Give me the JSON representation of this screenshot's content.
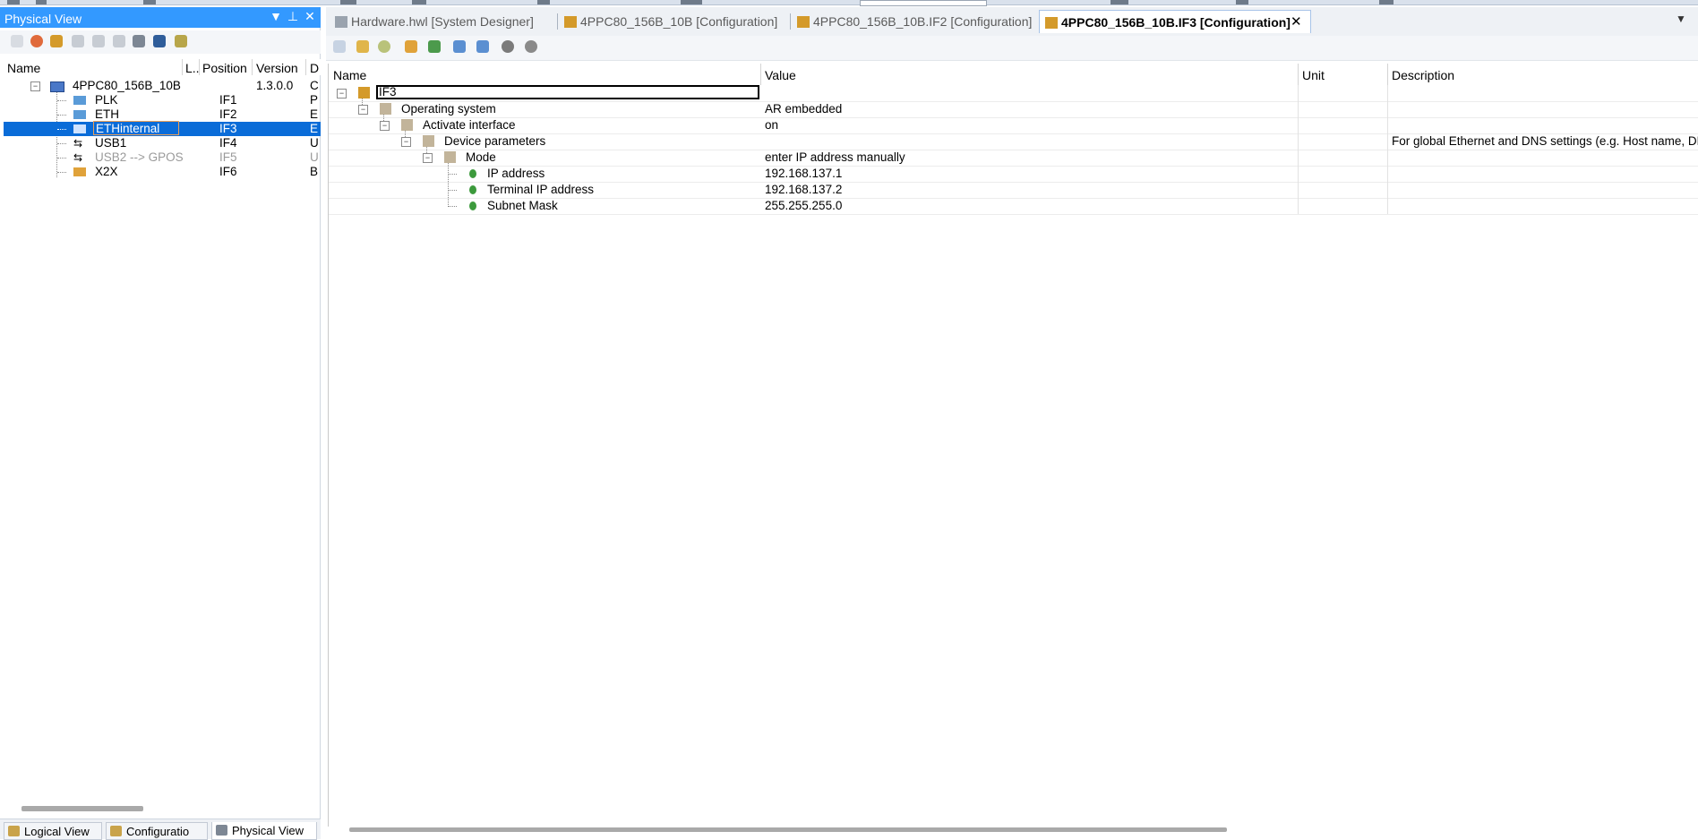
{
  "physical_view": {
    "title": "Physical View",
    "title_controls": {
      "dropdown": "▼",
      "pin": "⊥",
      "close": "✕"
    },
    "columns": {
      "name": "Name",
      "l": "L..",
      "position": "Position",
      "version": "Version",
      "d": "D"
    },
    "rows": [
      {
        "name": "4PPC80_156B_10B",
        "position": "",
        "version": "1.3.0.0",
        "d": "C"
      },
      {
        "name": "PLK",
        "position": "IF1",
        "version": "",
        "d": "P"
      },
      {
        "name": "ETH",
        "position": "IF2",
        "version": "",
        "d": "E"
      },
      {
        "name": "ETHinternal",
        "position": "IF3",
        "version": "",
        "d": "E"
      },
      {
        "name": "USB1",
        "position": "IF4",
        "version": "",
        "d": "U"
      },
      {
        "name": "USB2 --> GPOS",
        "position": "IF5",
        "version": "",
        "d": "U"
      },
      {
        "name": "X2X",
        "position": "IF6",
        "version": "",
        "d": "B"
      }
    ],
    "bottom_tabs": [
      "Logical View",
      "Configuratio",
      "Physical View"
    ]
  },
  "document_tabs": [
    {
      "label": "Hardware.hwl [System Designer]"
    },
    {
      "label": "4PPC80_156B_10B [Configuration]"
    },
    {
      "label": "4PPC80_156B_10B.IF2 [Configuration]"
    },
    {
      "label": "4PPC80_156B_10B.IF3 [Configuration]"
    }
  ],
  "tab_close": "✕",
  "tab_dropdown": "▼",
  "config_grid": {
    "columns": {
      "name": "Name",
      "value": "Value",
      "unit": "Unit",
      "description": "Description"
    },
    "rows": [
      {
        "name": "IF3",
        "value": "",
        "unit": "",
        "description": ""
      },
      {
        "name": "Operating system",
        "value": "AR embedded",
        "unit": "",
        "description": ""
      },
      {
        "name": "Activate interface",
        "value": "on",
        "unit": "",
        "description": ""
      },
      {
        "name": "Device parameters",
        "value": "",
        "unit": "",
        "description": "For global Ethernet and DNS settings (e.g. Host name, DNS"
      },
      {
        "name": "Mode",
        "value": "enter IP address manually",
        "unit": "",
        "description": ""
      },
      {
        "name": "IP address",
        "value": "192.168.137.1",
        "unit": "",
        "description": ""
      },
      {
        "name": "Terminal IP address",
        "value": "192.168.137.2",
        "unit": "",
        "description": ""
      },
      {
        "name": "Subnet Mask",
        "value": "255.255.255.0",
        "unit": "",
        "description": ""
      }
    ]
  },
  "colors": {
    "title_bar": "#3399ff",
    "selection": "#0a6cd8",
    "leaf_icon": "#3c9a3c"
  }
}
